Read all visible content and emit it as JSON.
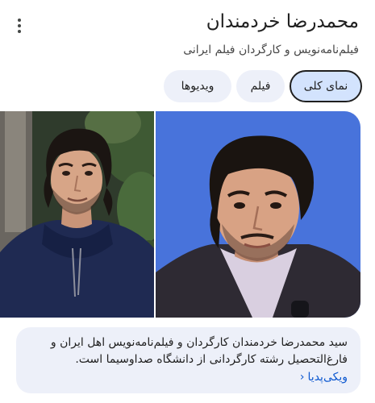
{
  "header": {
    "title": "محمدرضا خردمندان",
    "subtitle": "فیلم‌نامه‌نویس و کارگردان فیلم ایرانی"
  },
  "tabs": [
    {
      "label": "نمای کلی",
      "active": true
    },
    {
      "label": "فیلم",
      "active": false
    },
    {
      "label": "ویدیوها",
      "active": false
    }
  ],
  "description": {
    "text": "سید محمدرضا خردمندان کارگردان و فیلم‌نامه‌نویس اهل ایران و فارغ‌التحصیل رشته کارگردانی از دانشگاه صداوسیما است.",
    "link_label": "ویکی‌پدیا",
    "link_icon": "chevron-left-icon"
  },
  "colors": {
    "accent": "#0b57d0",
    "chip_bg": "#edf0f9",
    "chip_active_bg": "#d3e3fd"
  }
}
